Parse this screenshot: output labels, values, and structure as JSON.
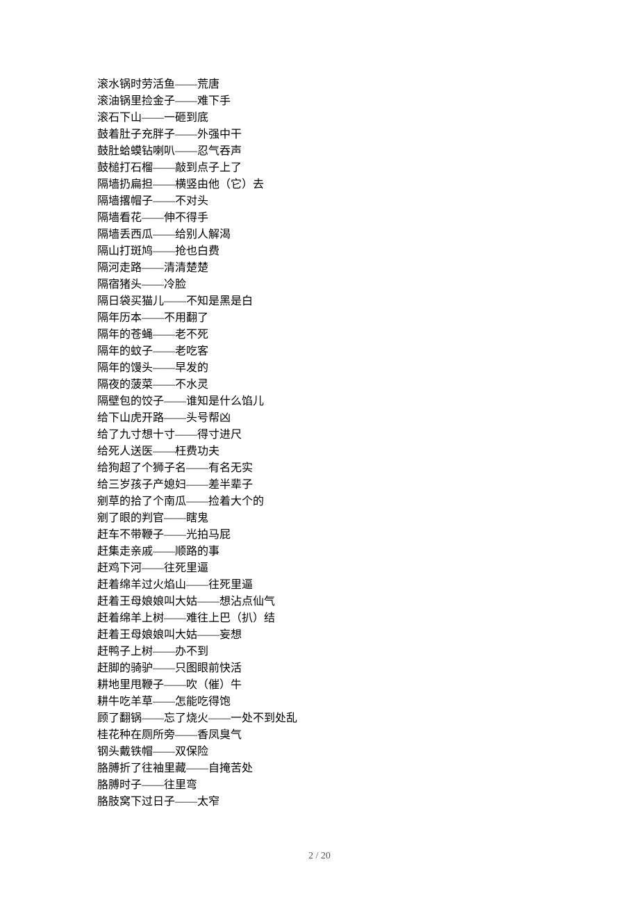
{
  "lines": [
    "滚水锅时劳活鱼——荒唐",
    "滚油锅里捡金子——难下手",
    "滚石下山——一砸到底",
    "鼓着肚子充胖子——外强中干",
    "鼓肚蛤蟆钻喇叭——忍气吞声",
    "鼓槌打石榴——敲到点子上了",
    "隔墙扔扁担——横竖由他（它）去",
    "隔墙撂帽子——不对头",
    "隔墙看花——伸不得手",
    "隔墙丢西瓜——给别人解渴",
    "隔山打斑鸠——抢也白费",
    "隔河走路——清清楚楚",
    "隔宿猪头——冷脸",
    "隔日袋买猫儿——不知是黑是白",
    "隔年历本——不用翻了",
    "隔年的苍蝇——老不死",
    "隔年的蚊子——老吃客",
    "隔年的馒头——早发的",
    "隔夜的菠菜——不水灵",
    "隔壁包的饺子——谁知是什么馅儿",
    "给下山虎开路——头号帮凶",
    "给了九寸想十寸——得寸进尺",
    "给死人送医——枉费功夫",
    "给狗超了个狮子名——有名无实",
    "给三岁孩子产媳妇——差半辈子",
    "剜草的拾了个南瓜——捡着大个的",
    "剜了眼的判官——瞎鬼",
    "赶车不带鞭子——光拍马屁",
    "赶集走亲戚——顺路的事",
    "赶鸡下河——往死里逼",
    "赶着绵羊过火焰山——往死里逼",
    "赶着王母娘娘叫大姑——想沾点仙气",
    "赶着绵羊上树——难往上巴（扒）结",
    "赶着王母娘娘叫大姑——妄想",
    "赶鸭子上树——办不到",
    "赶脚的骑驴——只图眼前快活",
    "耕地里甩鞭子——吹（催）牛",
    "耕牛吃羊草——怎能吃得饱",
    "顾了翻锅——忘了烧火——一处不到处乱",
    "桂花种在厕所旁——香凤臭气",
    "钢头戴铁帽——双保险",
    "胳膊折了往袖里藏——自掩苦处",
    "胳膊时子——往里弯",
    "胳肢窝下过日子——太窄"
  ],
  "footer": "2  /  20"
}
